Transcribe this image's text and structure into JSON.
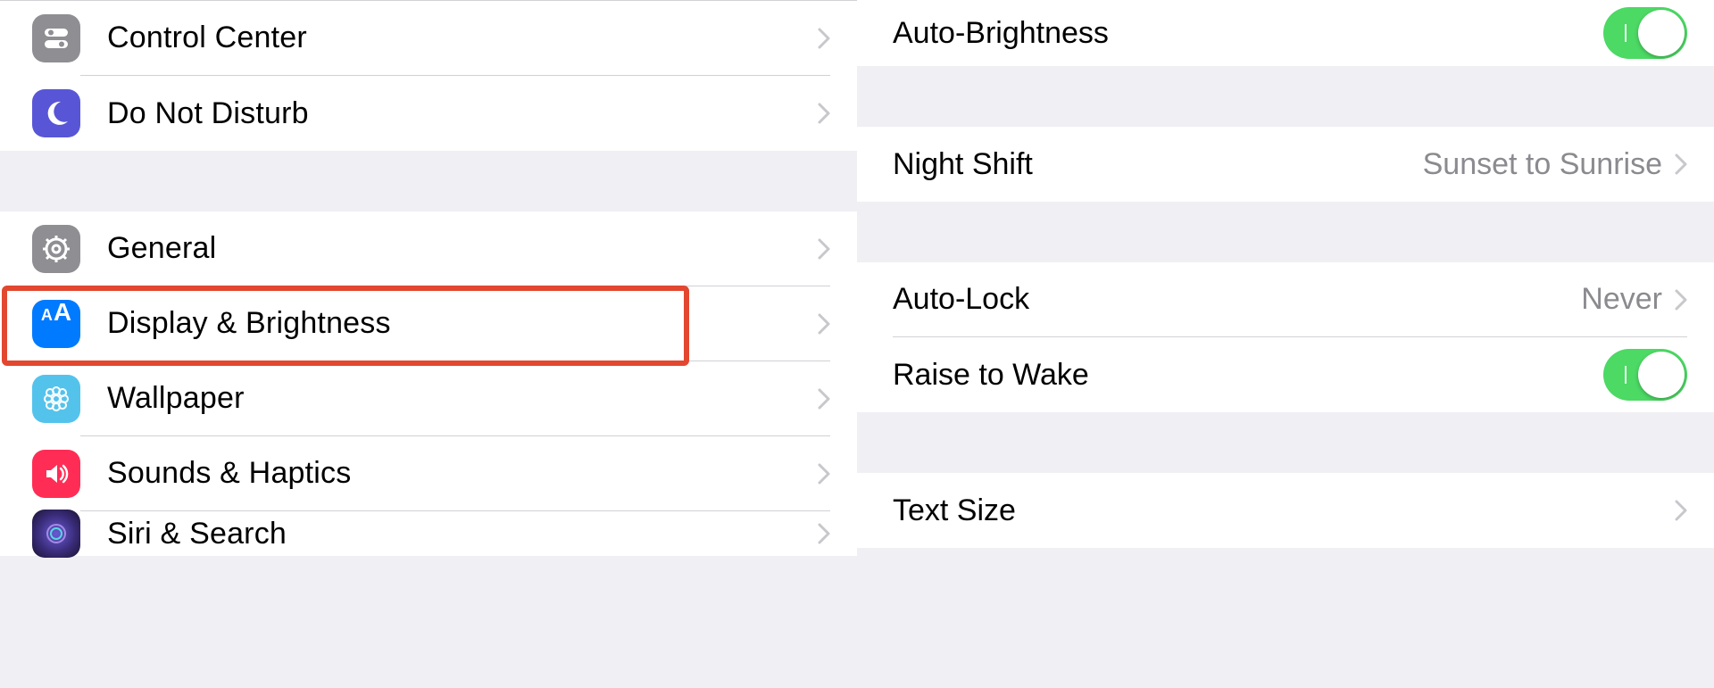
{
  "left": {
    "groups": [
      {
        "items": [
          {
            "key": "control-center",
            "label": "Control Center"
          },
          {
            "key": "do-not-disturb",
            "label": "Do Not Disturb"
          }
        ]
      },
      {
        "items": [
          {
            "key": "general",
            "label": "General"
          },
          {
            "key": "display-brightness",
            "label": "Display & Brightness",
            "highlighted": true
          },
          {
            "key": "wallpaper",
            "label": "Wallpaper"
          },
          {
            "key": "sounds-haptics",
            "label": "Sounds & Haptics"
          },
          {
            "key": "siri-search",
            "label": "Siri & Search"
          }
        ]
      }
    ]
  },
  "right": {
    "auto_brightness": {
      "label": "Auto-Brightness",
      "on": true
    },
    "night_shift": {
      "label": "Night Shift",
      "value": "Sunset to Sunrise"
    },
    "auto_lock": {
      "label": "Auto-Lock",
      "value": "Never"
    },
    "raise_to_wake": {
      "label": "Raise to Wake",
      "on": true
    },
    "text_size": {
      "label": "Text Size"
    }
  },
  "colors": {
    "highlight": "#e2472f",
    "toggle_on": "#4cd964",
    "chevron": "#c7c7cc",
    "value_grey": "#8a8a8f"
  }
}
